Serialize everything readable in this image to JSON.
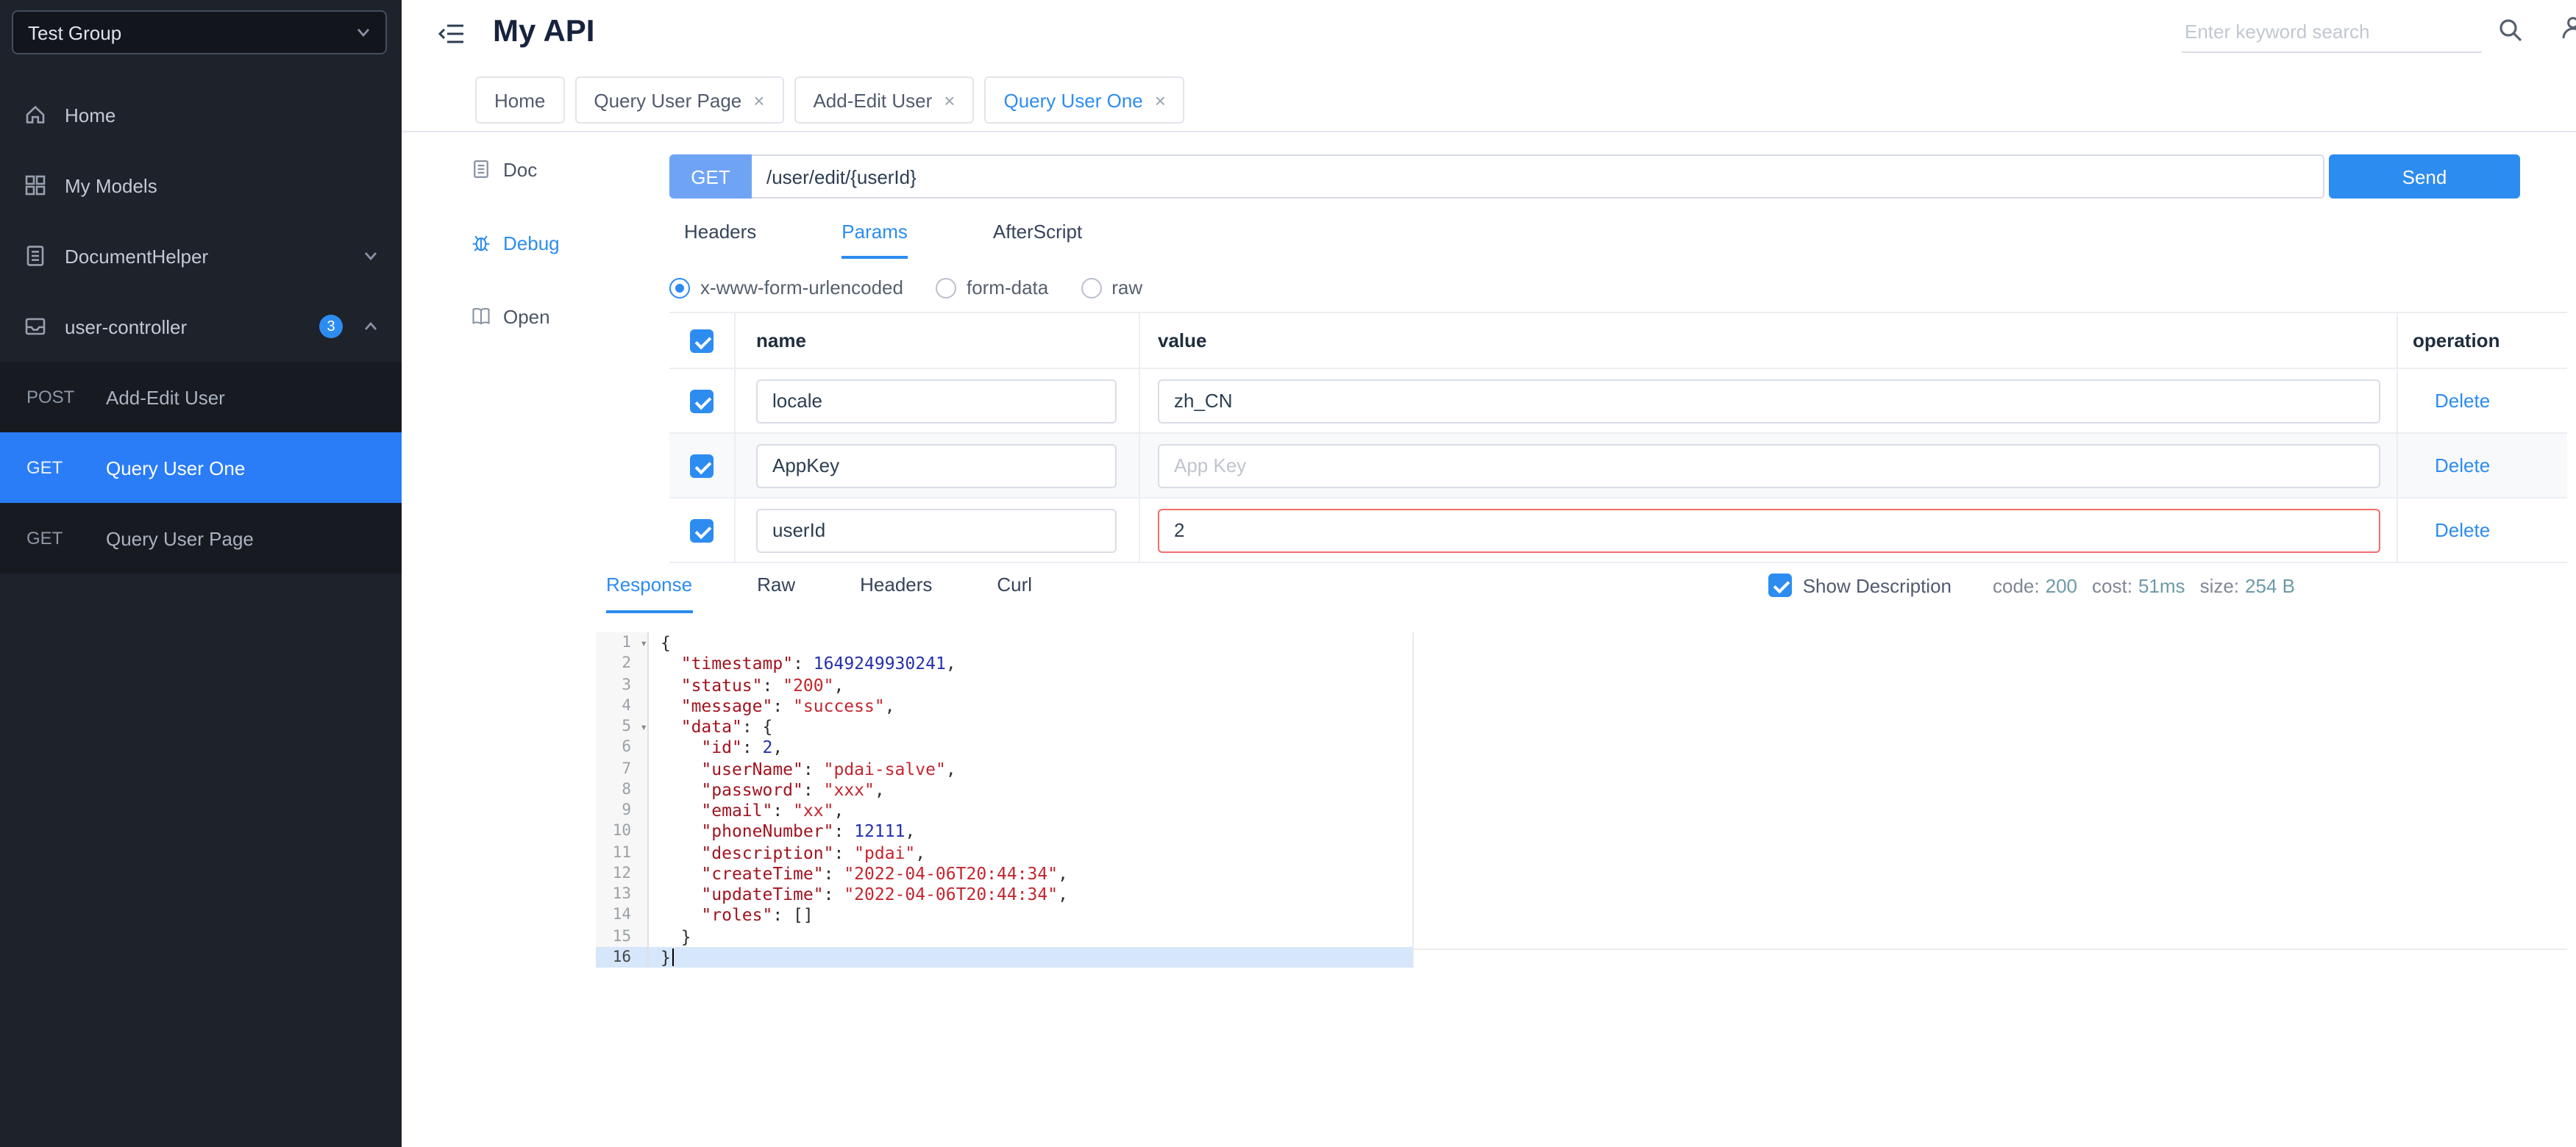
{
  "colors": {
    "primary": "#2d8cf0",
    "sidebar-active": "#2a7cf7",
    "method-btn": "#6fa4f5",
    "danger": "#f56c6c"
  },
  "icons": {
    "close": "×",
    "fold": "▾"
  },
  "app": {
    "title": "My API",
    "search_placeholder": "Enter keyword search"
  },
  "sidebar": {
    "group_select": "Test Group",
    "items": [
      {
        "label": "Home"
      },
      {
        "label": "My Models"
      },
      {
        "label": "DocumentHelper"
      },
      {
        "label": "user-controller",
        "badge": "3"
      }
    ],
    "sub_items": [
      {
        "method": "POST",
        "label": "Add-Edit User",
        "selected": false
      },
      {
        "method": "GET",
        "label": "Query User One",
        "selected": true
      },
      {
        "method": "GET",
        "label": "Query User Page",
        "selected": false
      }
    ]
  },
  "tabs": [
    {
      "label": "Home",
      "closable": false,
      "active": false
    },
    {
      "label": "Query User Page",
      "closable": true,
      "active": false
    },
    {
      "label": "Add-Edit User",
      "closable": true,
      "active": false
    },
    {
      "label": "Query User One",
      "closable": true,
      "active": true
    }
  ],
  "rail": [
    {
      "label": "Doc",
      "active": false
    },
    {
      "label": "Debug",
      "active": true
    },
    {
      "label": "Open",
      "active": false
    }
  ],
  "request": {
    "method": "GET",
    "url": "/user/edit/{userId}",
    "send_label": "Send"
  },
  "request_tabs": [
    {
      "label": "Headers",
      "active": false
    },
    {
      "label": "Params",
      "active": true
    },
    {
      "label": "AfterScript",
      "active": false
    }
  ],
  "body_types": [
    {
      "label": "x-www-form-urlencoded",
      "selected": true
    },
    {
      "label": "form-data",
      "selected": false
    },
    {
      "label": "raw",
      "selected": false
    }
  ],
  "params_table": {
    "columns": [
      "name",
      "value",
      "operation"
    ],
    "rows": [
      {
        "checked": true,
        "name": "locale",
        "value": "zh_CN",
        "value_placeholder": "",
        "operation": "Delete",
        "invalid": false
      },
      {
        "checked": true,
        "name": "AppKey",
        "value": "",
        "value_placeholder": "App Key",
        "operation": "Delete",
        "invalid": false
      },
      {
        "checked": true,
        "name": "userId",
        "value": "2",
        "value_placeholder": "",
        "operation": "Delete",
        "invalid": true
      }
    ]
  },
  "response_tabs": [
    {
      "label": "Response",
      "active": true
    },
    {
      "label": "Raw",
      "active": false
    },
    {
      "label": "Headers",
      "active": false
    },
    {
      "label": "Curl",
      "active": false
    }
  ],
  "response_meta": {
    "show_description_label": "Show Description",
    "show_description_checked": true,
    "code_label": "code:",
    "code_value": "200",
    "cost_label": "cost:",
    "cost_value": "51ms",
    "size_label": "size:",
    "size_value": "254 B"
  },
  "editor": {
    "lines": [
      {
        "n": 1,
        "fold": true,
        "tokens": [
          [
            "pl",
            "{"
          ]
        ]
      },
      {
        "n": 2,
        "tokens": [
          [
            "pl",
            "  "
          ],
          [
            "key",
            "\"timestamp\""
          ],
          [
            "pl",
            ": "
          ],
          [
            "num",
            "1649249930241"
          ],
          [
            "pl",
            ","
          ]
        ]
      },
      {
        "n": 3,
        "tokens": [
          [
            "pl",
            "  "
          ],
          [
            "key",
            "\"status\""
          ],
          [
            "pl",
            ": "
          ],
          [
            "str",
            "\"200\""
          ],
          [
            "pl",
            ","
          ]
        ]
      },
      {
        "n": 4,
        "tokens": [
          [
            "pl",
            "  "
          ],
          [
            "key",
            "\"message\""
          ],
          [
            "pl",
            ": "
          ],
          [
            "str",
            "\"success\""
          ],
          [
            "pl",
            ","
          ]
        ]
      },
      {
        "n": 5,
        "fold": true,
        "tokens": [
          [
            "pl",
            "  "
          ],
          [
            "key",
            "\"data\""
          ],
          [
            "pl",
            ": {"
          ]
        ]
      },
      {
        "n": 6,
        "tokens": [
          [
            "pl",
            "    "
          ],
          [
            "key",
            "\"id\""
          ],
          [
            "pl",
            ": "
          ],
          [
            "num",
            "2"
          ],
          [
            "pl",
            ","
          ]
        ]
      },
      {
        "n": 7,
        "tokens": [
          [
            "pl",
            "    "
          ],
          [
            "key",
            "\"userName\""
          ],
          [
            "pl",
            ": "
          ],
          [
            "str",
            "\"pdai-salve\""
          ],
          [
            "pl",
            ","
          ]
        ]
      },
      {
        "n": 8,
        "tokens": [
          [
            "pl",
            "    "
          ],
          [
            "key",
            "\"password\""
          ],
          [
            "pl",
            ": "
          ],
          [
            "str",
            "\"xxx\""
          ],
          [
            "pl",
            ","
          ]
        ]
      },
      {
        "n": 9,
        "tokens": [
          [
            "pl",
            "    "
          ],
          [
            "key",
            "\"email\""
          ],
          [
            "pl",
            ": "
          ],
          [
            "str",
            "\"xx\""
          ],
          [
            "pl",
            ","
          ]
        ]
      },
      {
        "n": 10,
        "tokens": [
          [
            "pl",
            "    "
          ],
          [
            "key",
            "\"phoneNumber\""
          ],
          [
            "pl",
            ": "
          ],
          [
            "num",
            "12111"
          ],
          [
            "pl",
            ","
          ]
        ]
      },
      {
        "n": 11,
        "tokens": [
          [
            "pl",
            "    "
          ],
          [
            "key",
            "\"description\""
          ],
          [
            "pl",
            ": "
          ],
          [
            "str",
            "\"pdai\""
          ],
          [
            "pl",
            ","
          ]
        ]
      },
      {
        "n": 12,
        "tokens": [
          [
            "pl",
            "    "
          ],
          [
            "key",
            "\"createTime\""
          ],
          [
            "pl",
            ": "
          ],
          [
            "str",
            "\"2022-04-06T20:44:34\""
          ],
          [
            "pl",
            ","
          ]
        ]
      },
      {
        "n": 13,
        "tokens": [
          [
            "pl",
            "    "
          ],
          [
            "key",
            "\"updateTime\""
          ],
          [
            "pl",
            ": "
          ],
          [
            "str",
            "\"2022-04-06T20:44:34\""
          ],
          [
            "pl",
            ","
          ]
        ]
      },
      {
        "n": 14,
        "tokens": [
          [
            "pl",
            "    "
          ],
          [
            "key",
            "\"roles\""
          ],
          [
            "pl",
            ": []"
          ]
        ]
      },
      {
        "n": 15,
        "tokens": [
          [
            "pl",
            "  }"
          ]
        ]
      },
      {
        "n": 16,
        "active": true,
        "tokens": [
          [
            "pl",
            "}"
          ]
        ]
      }
    ]
  }
}
